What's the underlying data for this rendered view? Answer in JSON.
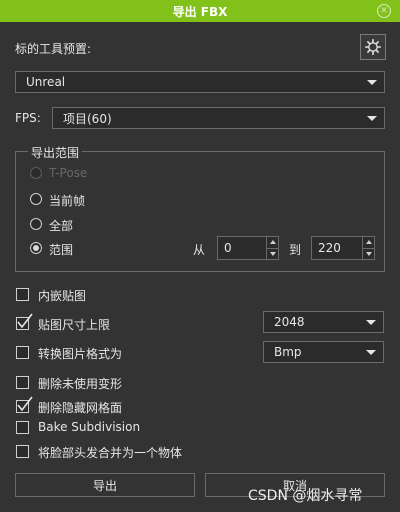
{
  "window": {
    "title": "导出 FBX"
  },
  "preset": {
    "label": "标的工具预置:",
    "value": "Unreal"
  },
  "fps": {
    "label": "FPS:",
    "value": "项目(60)"
  },
  "range": {
    "title": "导出范围",
    "options": [
      "T-Pose",
      "当前帧",
      "全部",
      "范围"
    ],
    "selected": "范围",
    "from_label": "从",
    "from_value": "0",
    "to_label": "到",
    "to_value": "220"
  },
  "options": {
    "embed_textures": {
      "label": "内嵌贴图",
      "checked": false
    },
    "texture_size_limit": {
      "label": "贴图尺寸上限",
      "checked": true,
      "value": "2048"
    },
    "convert_image_format": {
      "label": "转换图片格式为",
      "checked": false,
      "value": "Bmp"
    },
    "delete_unused_morphs": {
      "label": "删除未使用变形",
      "checked": false
    },
    "delete_hidden_mesh": {
      "label": "删除隐藏网格面",
      "checked": true
    },
    "bake_subdivision": {
      "label": "Bake Subdivision",
      "checked": false
    },
    "merge_face_head": {
      "label": "将脸部头发合并为一个物体",
      "checked": false
    }
  },
  "buttons": {
    "export": "导出",
    "cancel": "取消"
  },
  "watermark": "CSDN @烟水寻常",
  "colors": {
    "titlebar": "#82c01a",
    "background": "#333333"
  }
}
